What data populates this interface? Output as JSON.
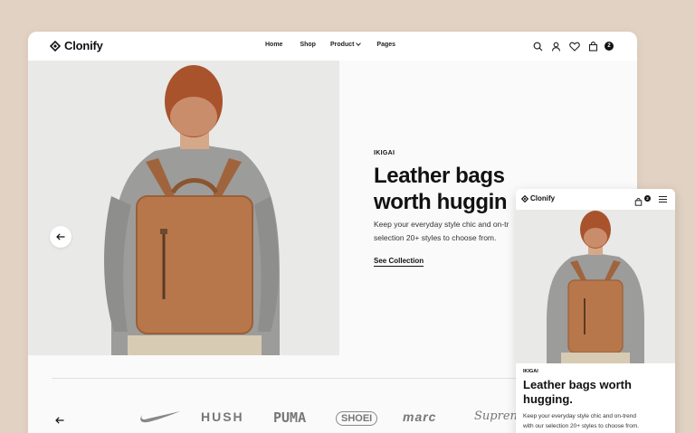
{
  "brand": {
    "name": "Clonify"
  },
  "nav": {
    "items": [
      "Home",
      "Shop",
      "Product",
      "Pages"
    ]
  },
  "header": {
    "cart_count": "2"
  },
  "hero": {
    "eyebrow": "IKIGAI",
    "title_line1": "Leather bags",
    "title_line2": "worth huggin",
    "subtitle_line1": "Keep your everyday style chic and on-tr",
    "subtitle_line2": "selection 20+ styles to choose from.",
    "cta": "See Collection"
  },
  "brands": {
    "items": [
      "HUSH",
      "PUMA",
      "SHOEI",
      "marc",
      "Supren"
    ]
  },
  "mobile": {
    "brand": "Clonify",
    "cart_count": "2",
    "eyebrow": "IKIGAI",
    "title_line1": "Leather bags worth",
    "title_line2": "hugging.",
    "subtitle_line1": "Keep your everyday style chic and on-trend",
    "subtitle_line2": "with our selection 20+ styles to choose from."
  },
  "colors": {
    "background": "#e1d2c3",
    "bag": "#b8774b",
    "sweater": "#9c9c9a",
    "hair": "#a8532c"
  }
}
